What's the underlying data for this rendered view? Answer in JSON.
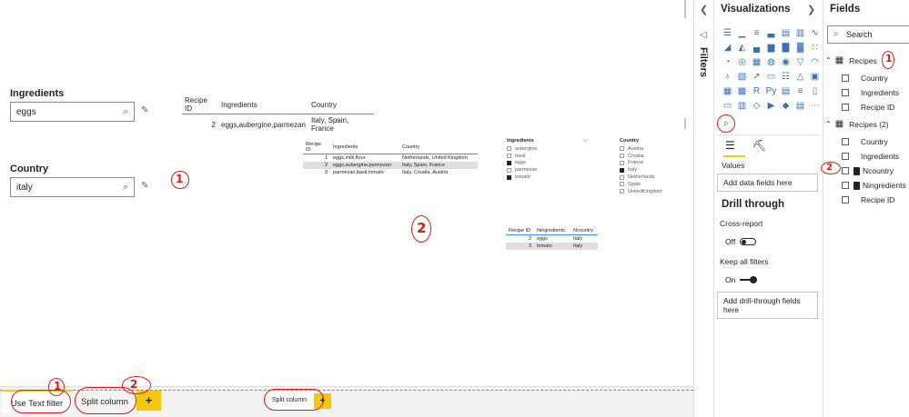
{
  "report": {
    "text_slicer_1": {
      "title": "Ingredients",
      "value": "eggs"
    },
    "text_slicer_2": {
      "title": "Country",
      "value": "italy"
    },
    "table_main": {
      "headers": [
        "Recipe ID",
        "Ingredients",
        "Country"
      ],
      "rows": [
        [
          "2",
          "eggs,aubergine,parmezan",
          "Italy, Spain, France"
        ]
      ]
    },
    "table_small": {
      "headers": [
        "Recipe ID",
        "Ingredients",
        "Country"
      ],
      "rows": [
        [
          "1",
          "eggs,milk,flour",
          "Netherlands, United Kingdom"
        ],
        [
          "2",
          "eggs,aubergine,parmezan",
          "Italy, Spain, France"
        ],
        [
          "3",
          "parmezan,basil,tomato",
          "Italy, Croatia, Austria"
        ]
      ]
    },
    "ingredients_slicer": {
      "title": "Ingredients",
      "items": [
        "aubergine",
        "basil",
        "eggs",
        "parmezan",
        "tomato"
      ],
      "selected": [
        "eggs",
        "tomato"
      ]
    },
    "country_slicer": {
      "title": "Country",
      "items": [
        "Austria",
        "Croatia",
        "France",
        "Italy",
        "Netherlands",
        "Spain",
        "UnitedKingdom"
      ],
      "selected": [
        "Italy"
      ]
    },
    "table_split": {
      "headers": [
        "Recipe ID",
        "Ningredients",
        "Ncountry"
      ],
      "rows": [
        [
          "2",
          "eggs",
          "Italy"
        ],
        [
          "3",
          "tomato",
          "Italy"
        ]
      ]
    }
  },
  "annotations": {
    "mark_1": "1",
    "mark_2": "2"
  },
  "tabs": {
    "tab1": "Use Text filter",
    "tab2": "Split column",
    "tab3": "Split column",
    "add": "+"
  },
  "filters_pane": {
    "label": "Filters"
  },
  "viz_pane": {
    "title": "Visualizations",
    "values_label": "Values",
    "values_placeholder": "Add data fields here",
    "drill_title": "Drill through",
    "cross_report": "Cross-report",
    "cross_report_state": "Off",
    "keep_filters": "Keep all filters",
    "keep_filters_state": "On",
    "drill_placeholder": "Add drill-through fields here"
  },
  "fields_pane": {
    "title": "Fields",
    "search_placeholder": "Search",
    "tables": [
      {
        "name": "Recipes",
        "fields": [
          "Country",
          "Ingredients",
          "Recipe ID"
        ]
      },
      {
        "name": "Recipes (2)",
        "fields": [
          "Country",
          "Ingredients",
          "Ncountry",
          "Ningredients",
          "Recipe ID"
        ]
      }
    ]
  },
  "colors": {
    "accent": "#f2c811",
    "annotation": "#e01818",
    "table_rule": "#3a96dd"
  }
}
